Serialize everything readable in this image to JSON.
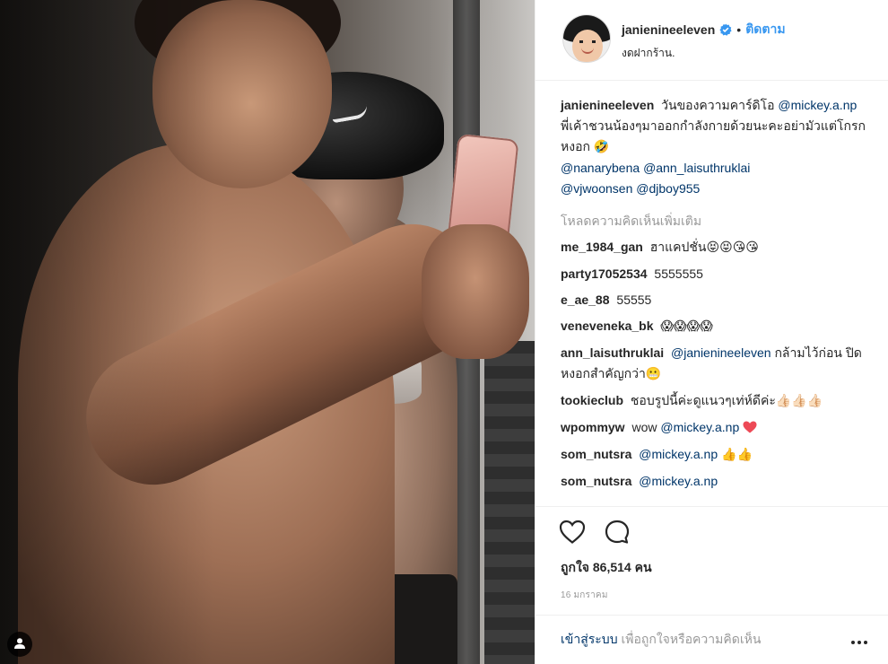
{
  "post": {
    "image_alt_icon": "user-tag-icon"
  },
  "header": {
    "username": "janienineeleven",
    "verified_icon": "verified-badge-icon",
    "separator": "•",
    "follow_label": "ติดตาม",
    "location": "งดฝากร้าน."
  },
  "caption": {
    "author": "janienineeleven",
    "text_1": "วันของความคาร์ดิโอ",
    "mention_1": "@mickey.a.np",
    "text_2": "พี่เค้าชวนน้องๆมาออกกำลังกายด้วยนะคะอย่ามัวแต่โกรกหงอก",
    "emoji": "🤣",
    "mention_2": "@nanarybena",
    "mention_3": "@ann_laisuthruklai",
    "mention_4": "@vjwoonsen",
    "mention_5": "@djboy955"
  },
  "load_more_label": "โหลดความคิดเห็นเพิ่มเติม",
  "comments": [
    {
      "author": "me_1984_gan",
      "text": "ฮาแคปชั่น",
      "emoji": "😝😝😘😘"
    },
    {
      "author": "party17052534",
      "text": "5555555",
      "emoji": ""
    },
    {
      "author": "e_ae_88",
      "text": "55555",
      "emoji": ""
    },
    {
      "author": "veneveneka_bk",
      "text": "",
      "emoji": "😱😱😱😱"
    },
    {
      "author": "ann_laisuthruklai",
      "mention": "@janienineeleven",
      "text": "กล้ามไว้ก่อน ปิดหงอกสำคัญกว่า",
      "emoji": "😬"
    },
    {
      "author": "tookieclub",
      "text": "ชอบรูปนี้ค่ะดูแนวๆเท่ห์ดีค่ะ",
      "emoji": "👍🏻👍🏻👍🏻"
    },
    {
      "author": "wpommyw",
      "text": "wow",
      "mention": "@mickey.a.np",
      "emoji": "❤️"
    },
    {
      "author": "som_nutsra",
      "mention": "@mickey.a.np",
      "emoji": "👍👍"
    },
    {
      "author": "som_nutsra",
      "mention": "@mickey.a.np",
      "emoji": ""
    }
  ],
  "actions": {
    "like_icon": "heart-icon",
    "comment_icon": "comment-bubble-icon"
  },
  "likes": "ถูกใจ 86,514 คน",
  "date": "16 มกราคม",
  "footer": {
    "login_label": "เข้าสู่ระบบ",
    "suffix": "เพื่อถูกใจหรือความคิดเห็น",
    "more_icon": "more-options-icon"
  },
  "colors": {
    "link_blue": "#3897f0",
    "mention": "#003569",
    "muted": "#999999",
    "heart_red": "#ed4956"
  }
}
